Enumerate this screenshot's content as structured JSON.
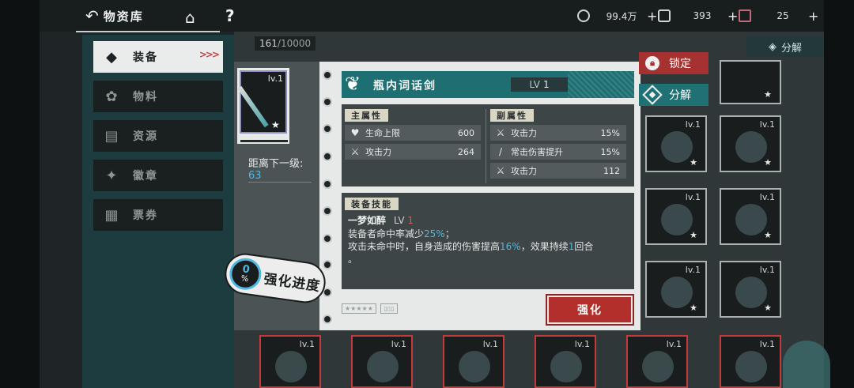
{
  "topbar": {
    "back_label": "物资库",
    "resources": [
      {
        "icon": "coin-icon",
        "value": "99.4万"
      },
      {
        "icon": "ticket-icon",
        "value": "393"
      },
      {
        "icon": "crystal-icon",
        "value": "25"
      }
    ]
  },
  "menu": {
    "items": [
      {
        "label": "装备",
        "icon": "equipment-icon",
        "active": true
      },
      {
        "label": "物料",
        "icon": "materials-icon",
        "active": false
      },
      {
        "label": "资源",
        "icon": "resources-icon",
        "active": false
      },
      {
        "label": "徽章",
        "icon": "badge-icon",
        "active": false
      },
      {
        "label": "票券",
        "icon": "voucher-icon",
        "active": false
      }
    ]
  },
  "inventory": {
    "count": "161",
    "capacity": "/10000",
    "decompose_label": "分解",
    "slot_level": "lv.1"
  },
  "detail": {
    "item_level": "lv.1",
    "next_level_label": "距离下一级:",
    "next_level_value": "63",
    "name": "瓶内词话剑",
    "level_prefix": "LV",
    "level_value": "1",
    "main_title": "主属性",
    "main_attrs": [
      {
        "name": "生命上限",
        "value": "600",
        "icon": "heart-icon"
      },
      {
        "name": "攻击力",
        "value": "264",
        "icon": "crossed-swords-icon"
      }
    ],
    "sub_title": "副属性",
    "sub_attrs": [
      {
        "name": "攻击力",
        "value": "15%",
        "icon": "crossed-swords-icon"
      },
      {
        "name": "常击伤害提升",
        "value": "15%",
        "icon": "sword-icon"
      },
      {
        "name": "攻击力",
        "value": "112",
        "icon": "crossed-swords-icon"
      }
    ],
    "skill_title": "装备技能",
    "skill_name": "一梦如醉",
    "skill_level_prefix": "LV",
    "skill_level_value": "1",
    "skill_line1_a": "装备者命中率减少",
    "skill_line1_hl": "25%",
    "skill_line1_b": "；",
    "skill_line2_a": "攻击未命中时，自身造成的伤害提高",
    "skill_line2_hl": "16%",
    "skill_line2_b": "，效果持续",
    "skill_line2_hl2": "1",
    "skill_line2_c": "回合",
    "skill_line3": "。",
    "enhance_label": "强化",
    "lock_label": "锁定",
    "split_label": "分解"
  },
  "progress": {
    "value": "0",
    "unit": "%",
    "label": "强化进度"
  }
}
